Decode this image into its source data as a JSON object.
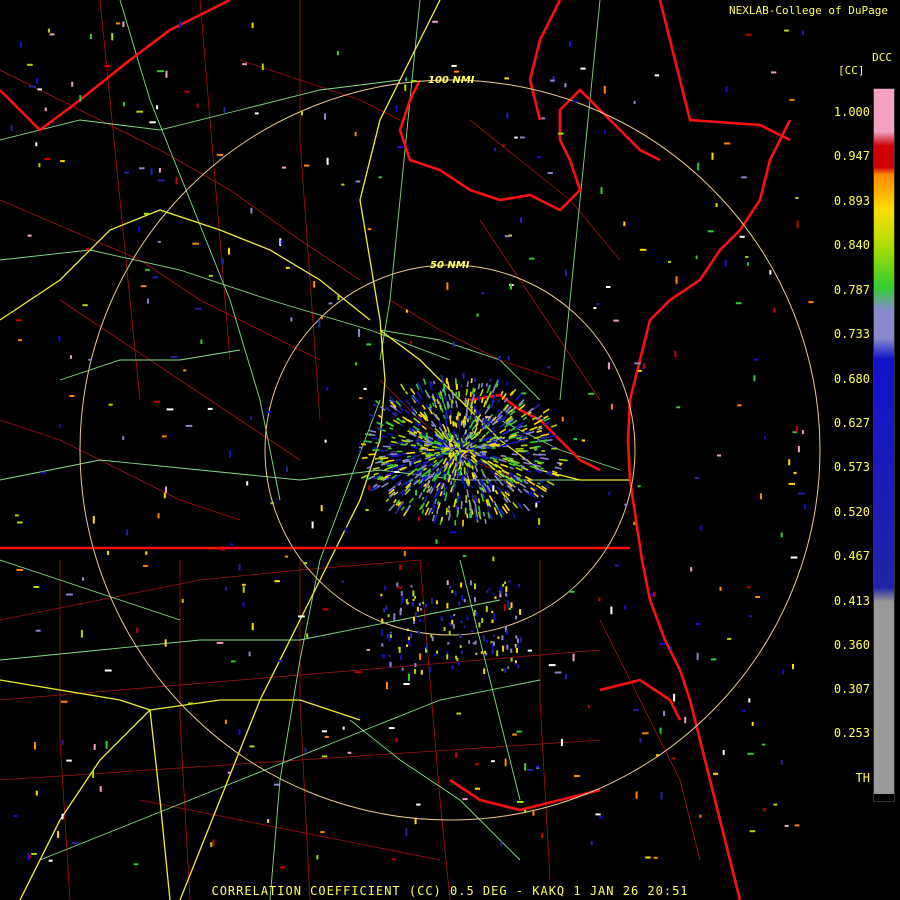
{
  "header": {
    "credit": "NEXLAB-College of DuPage"
  },
  "footer": {
    "product_line": "CORRELATION COEFFICIENT (CC) 0.5 DEG - KAKQ 1 JAN 26 20:51"
  },
  "map": {
    "range_rings": [
      "100 NMI",
      "50 NMI"
    ]
  },
  "legend": {
    "title": "DCC",
    "units": "[CC]",
    "labels": [
      "1.000",
      "0.947",
      "0.893",
      "0.840",
      "0.787",
      "0.733",
      "0.680",
      "0.627",
      "0.573",
      "0.520",
      "0.467",
      "0.413",
      "0.360",
      "0.307",
      "0.253",
      "TH"
    ],
    "colors": {
      "top": "#f4a0c0",
      "high": "#cc0000",
      "orange": "#ff8800",
      "yellow": "#ffdd00",
      "lime": "#aadd00",
      "green": "#33cc33",
      "lavender": "#8888cc",
      "blue": "#1111cc",
      "darkblue": "#2222aa",
      "gray": "#999999"
    }
  }
}
